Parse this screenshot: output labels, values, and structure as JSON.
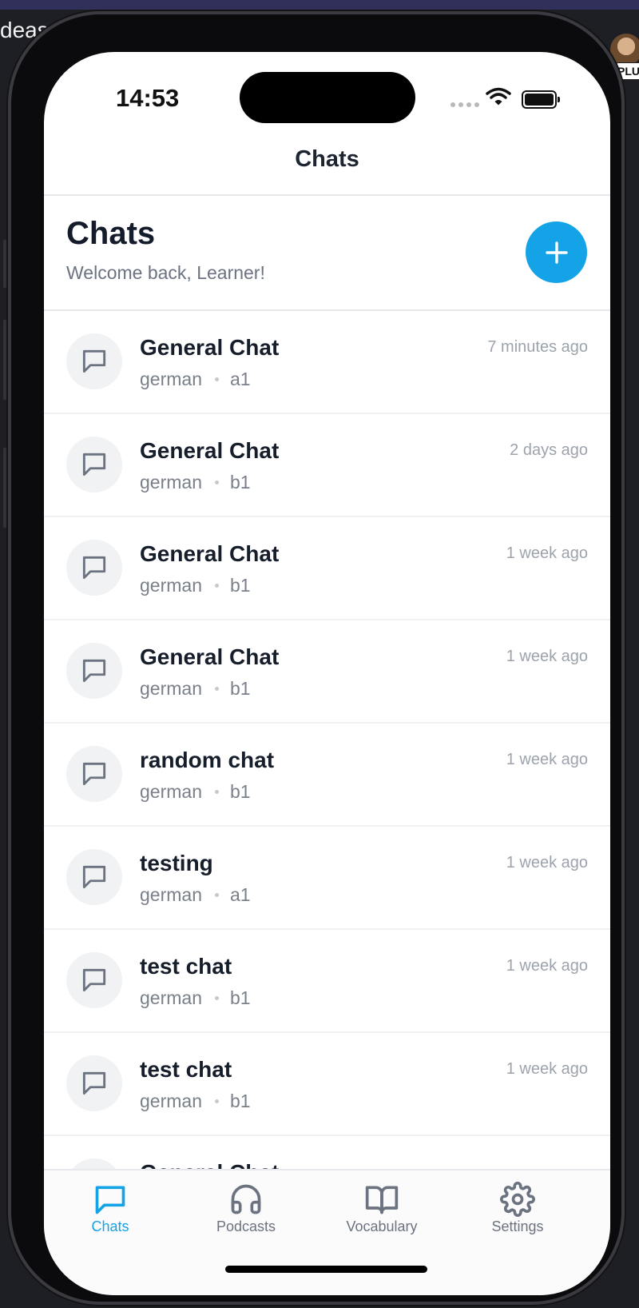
{
  "desktop": {
    "fragment_text": "deas.",
    "badge": "PLUS"
  },
  "status_bar": {
    "time": "14:53"
  },
  "nav": {
    "title": "Chats"
  },
  "header": {
    "title": "Chats",
    "subtitle": "Welcome back, Learner!"
  },
  "chats": [
    {
      "title": "General Chat",
      "language": "german",
      "level": "a1",
      "time": "7 minutes ago"
    },
    {
      "title": "General Chat",
      "language": "german",
      "level": "b1",
      "time": "2 days ago"
    },
    {
      "title": "General Chat",
      "language": "german",
      "level": "b1",
      "time": "1 week ago"
    },
    {
      "title": "General Chat",
      "language": "german",
      "level": "b1",
      "time": "1 week ago"
    },
    {
      "title": "random chat",
      "language": "german",
      "level": "b1",
      "time": "1 week ago"
    },
    {
      "title": "testing",
      "language": "german",
      "level": "a1",
      "time": "1 week ago"
    },
    {
      "title": "test chat",
      "language": "german",
      "level": "b1",
      "time": "1 week ago"
    },
    {
      "title": "test chat",
      "language": "german",
      "level": "b1",
      "time": "1 week ago"
    },
    {
      "title": "General Chat",
      "language": "",
      "level": "",
      "time": ""
    }
  ],
  "tabs": [
    {
      "label": "Chats",
      "icon": "chat-bubble-icon",
      "active": true
    },
    {
      "label": "Podcasts",
      "icon": "headphones-icon",
      "active": false
    },
    {
      "label": "Vocabulary",
      "icon": "book-icon",
      "active": false
    },
    {
      "label": "Settings",
      "icon": "gear-icon",
      "active": false
    }
  ],
  "colors": {
    "accent": "#14a3e6",
    "text_primary": "#161d2b",
    "text_secondary": "#7a808a",
    "muted": "#9ca3ad"
  }
}
